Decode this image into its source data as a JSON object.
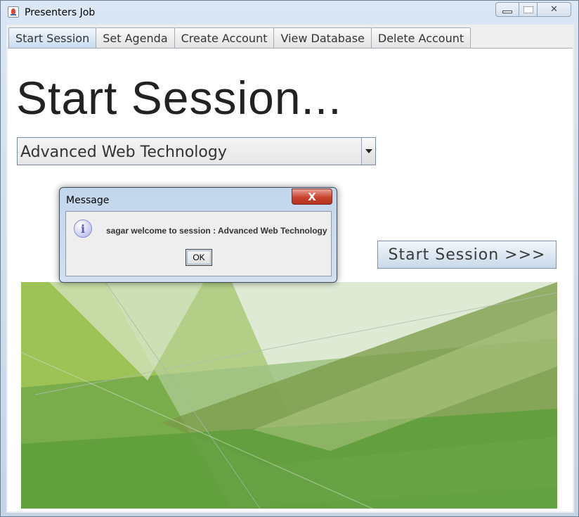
{
  "window": {
    "title": "Presenters Job",
    "icon": "java-cup-icon",
    "controls": {
      "minimize": "minimize-icon",
      "maximize": "maximize-icon",
      "close": "close-icon"
    }
  },
  "tabs": [
    {
      "label": "Start Session",
      "active": true
    },
    {
      "label": "Set Agenda",
      "active": false
    },
    {
      "label": "Create Account",
      "active": false
    },
    {
      "label": "View Database",
      "active": false
    },
    {
      "label": "Delete Account",
      "active": false
    }
  ],
  "main": {
    "heading": "Start Session...",
    "session_combo": {
      "selected": "Advanced Web Technology"
    },
    "start_button_label": "Start Session >>>"
  },
  "dialog": {
    "title": "Message",
    "close_glyph": "X",
    "icon": "info-icon",
    "message": "sagar welcome to session : Advanced Web Technology",
    "ok_label": "OK"
  },
  "colors": {
    "accent_active_tab": "#c8dcef",
    "dialog_close": "#c9432f",
    "art_green_light": "#9dc255",
    "art_green_dark": "#5f9e3d"
  }
}
